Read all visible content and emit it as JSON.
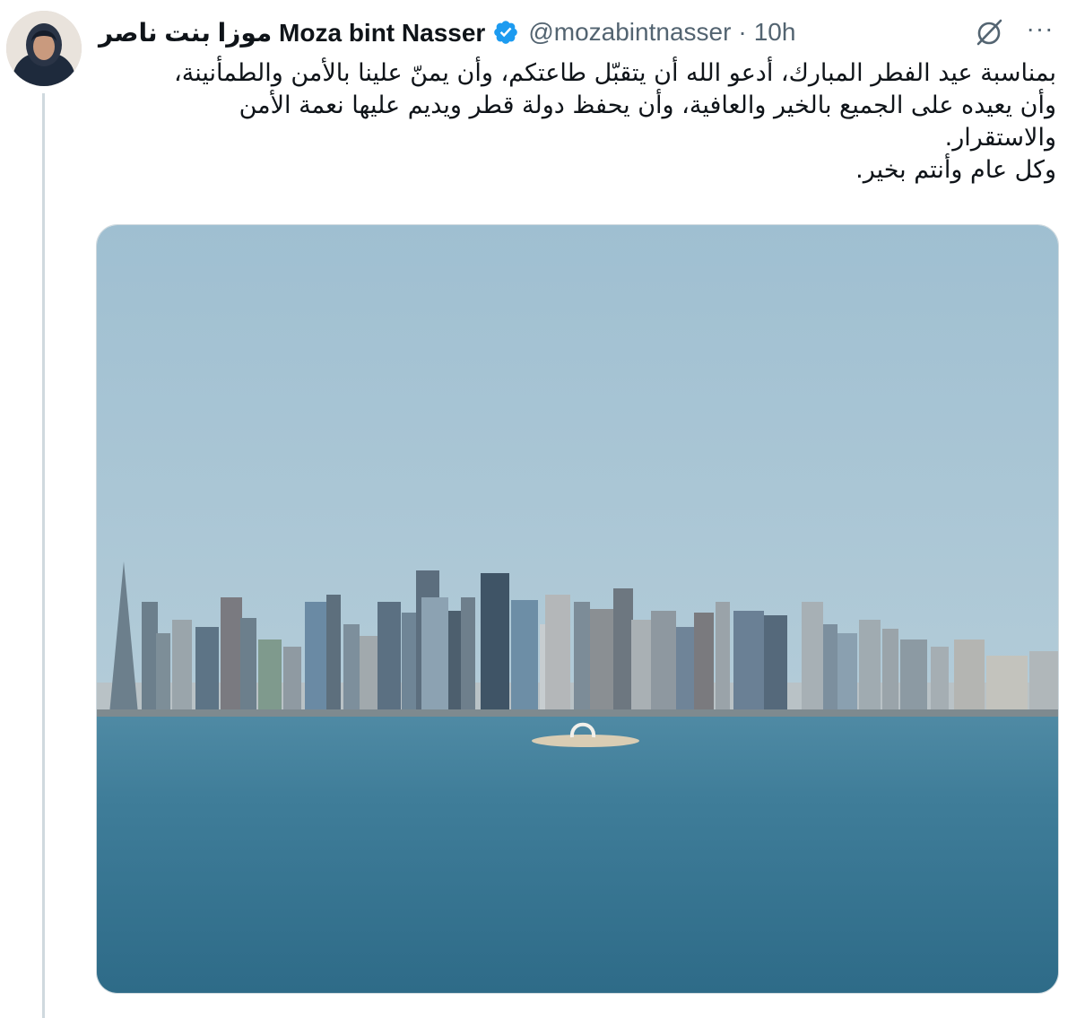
{
  "tweet": {
    "display_name": "موزا بنت ناصر Moza bint Nasser",
    "handle": "@mozabintnasser",
    "separator": "·",
    "time": "10h",
    "more_label": "···",
    "text_lines": [
      "بمناسبة عيد الفطر المبارك، أدعو الله أن يتقبّل طاعتكم، وأن يمنّ علينا بالأمن والطمأنينة،",
      "وأن يعيده على الجميع بالخير والعافية، وأن يحفظ دولة قطر ويديم عليها نعمة الأمن",
      "والاستقرار.",
      "وكل عام وأنتم بخير."
    ]
  },
  "icons": {
    "verified": "verified-badge-icon",
    "grok": "grok-icon",
    "more": "more-icon"
  },
  "colors": {
    "verified_blue": "#1d9bf0",
    "text": "#0f1419",
    "secondary": "#536471",
    "thread_line": "#cfd9de"
  }
}
